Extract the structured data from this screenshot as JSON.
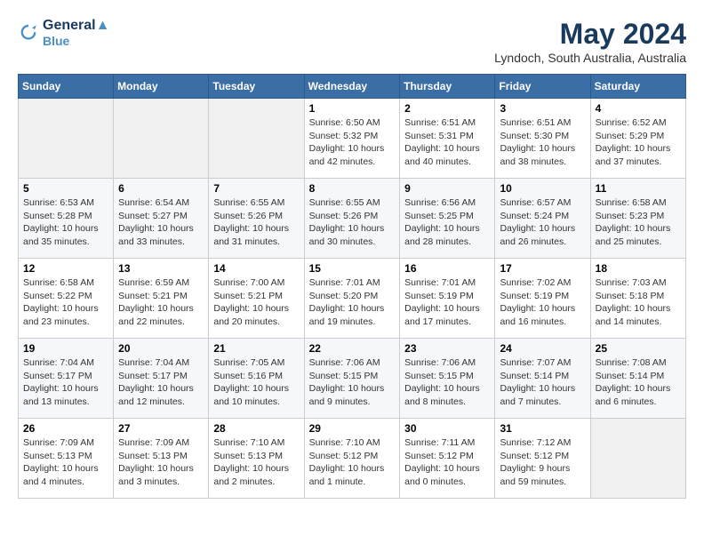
{
  "header": {
    "logo_line1": "General",
    "logo_line2": "Blue",
    "month": "May 2024",
    "location": "Lyndoch, South Australia, Australia"
  },
  "days_of_week": [
    "Sunday",
    "Monday",
    "Tuesday",
    "Wednesday",
    "Thursday",
    "Friday",
    "Saturday"
  ],
  "weeks": [
    [
      {
        "day": "",
        "info": ""
      },
      {
        "day": "",
        "info": ""
      },
      {
        "day": "",
        "info": ""
      },
      {
        "day": "1",
        "info": "Sunrise: 6:50 AM\nSunset: 5:32 PM\nDaylight: 10 hours\nand 42 minutes."
      },
      {
        "day": "2",
        "info": "Sunrise: 6:51 AM\nSunset: 5:31 PM\nDaylight: 10 hours\nand 40 minutes."
      },
      {
        "day": "3",
        "info": "Sunrise: 6:51 AM\nSunset: 5:30 PM\nDaylight: 10 hours\nand 38 minutes."
      },
      {
        "day": "4",
        "info": "Sunrise: 6:52 AM\nSunset: 5:29 PM\nDaylight: 10 hours\nand 37 minutes."
      }
    ],
    [
      {
        "day": "5",
        "info": "Sunrise: 6:53 AM\nSunset: 5:28 PM\nDaylight: 10 hours\nand 35 minutes."
      },
      {
        "day": "6",
        "info": "Sunrise: 6:54 AM\nSunset: 5:27 PM\nDaylight: 10 hours\nand 33 minutes."
      },
      {
        "day": "7",
        "info": "Sunrise: 6:55 AM\nSunset: 5:26 PM\nDaylight: 10 hours\nand 31 minutes."
      },
      {
        "day": "8",
        "info": "Sunrise: 6:55 AM\nSunset: 5:26 PM\nDaylight: 10 hours\nand 30 minutes."
      },
      {
        "day": "9",
        "info": "Sunrise: 6:56 AM\nSunset: 5:25 PM\nDaylight: 10 hours\nand 28 minutes."
      },
      {
        "day": "10",
        "info": "Sunrise: 6:57 AM\nSunset: 5:24 PM\nDaylight: 10 hours\nand 26 minutes."
      },
      {
        "day": "11",
        "info": "Sunrise: 6:58 AM\nSunset: 5:23 PM\nDaylight: 10 hours\nand 25 minutes."
      }
    ],
    [
      {
        "day": "12",
        "info": "Sunrise: 6:58 AM\nSunset: 5:22 PM\nDaylight: 10 hours\nand 23 minutes."
      },
      {
        "day": "13",
        "info": "Sunrise: 6:59 AM\nSunset: 5:21 PM\nDaylight: 10 hours\nand 22 minutes."
      },
      {
        "day": "14",
        "info": "Sunrise: 7:00 AM\nSunset: 5:21 PM\nDaylight: 10 hours\nand 20 minutes."
      },
      {
        "day": "15",
        "info": "Sunrise: 7:01 AM\nSunset: 5:20 PM\nDaylight: 10 hours\nand 19 minutes."
      },
      {
        "day": "16",
        "info": "Sunrise: 7:01 AM\nSunset: 5:19 PM\nDaylight: 10 hours\nand 17 minutes."
      },
      {
        "day": "17",
        "info": "Sunrise: 7:02 AM\nSunset: 5:19 PM\nDaylight: 10 hours\nand 16 minutes."
      },
      {
        "day": "18",
        "info": "Sunrise: 7:03 AM\nSunset: 5:18 PM\nDaylight: 10 hours\nand 14 minutes."
      }
    ],
    [
      {
        "day": "19",
        "info": "Sunrise: 7:04 AM\nSunset: 5:17 PM\nDaylight: 10 hours\nand 13 minutes."
      },
      {
        "day": "20",
        "info": "Sunrise: 7:04 AM\nSunset: 5:17 PM\nDaylight: 10 hours\nand 12 minutes."
      },
      {
        "day": "21",
        "info": "Sunrise: 7:05 AM\nSunset: 5:16 PM\nDaylight: 10 hours\nand 10 minutes."
      },
      {
        "day": "22",
        "info": "Sunrise: 7:06 AM\nSunset: 5:15 PM\nDaylight: 10 hours\nand 9 minutes."
      },
      {
        "day": "23",
        "info": "Sunrise: 7:06 AM\nSunset: 5:15 PM\nDaylight: 10 hours\nand 8 minutes."
      },
      {
        "day": "24",
        "info": "Sunrise: 7:07 AM\nSunset: 5:14 PM\nDaylight: 10 hours\nand 7 minutes."
      },
      {
        "day": "25",
        "info": "Sunrise: 7:08 AM\nSunset: 5:14 PM\nDaylight: 10 hours\nand 6 minutes."
      }
    ],
    [
      {
        "day": "26",
        "info": "Sunrise: 7:09 AM\nSunset: 5:13 PM\nDaylight: 10 hours\nand 4 minutes."
      },
      {
        "day": "27",
        "info": "Sunrise: 7:09 AM\nSunset: 5:13 PM\nDaylight: 10 hours\nand 3 minutes."
      },
      {
        "day": "28",
        "info": "Sunrise: 7:10 AM\nSunset: 5:13 PM\nDaylight: 10 hours\nand 2 minutes."
      },
      {
        "day": "29",
        "info": "Sunrise: 7:10 AM\nSunset: 5:12 PM\nDaylight: 10 hours\nand 1 minute."
      },
      {
        "day": "30",
        "info": "Sunrise: 7:11 AM\nSunset: 5:12 PM\nDaylight: 10 hours\nand 0 minutes."
      },
      {
        "day": "31",
        "info": "Sunrise: 7:12 AM\nSunset: 5:12 PM\nDaylight: 9 hours\nand 59 minutes."
      },
      {
        "day": "",
        "info": ""
      }
    ]
  ]
}
